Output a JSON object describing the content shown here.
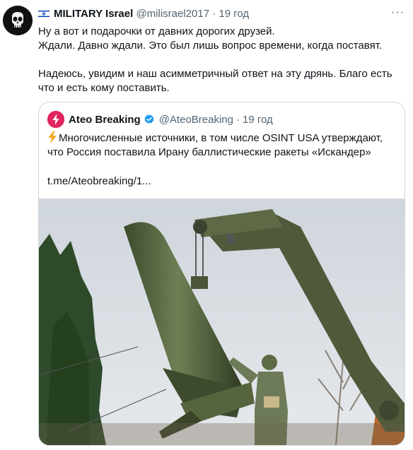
{
  "tweet": {
    "author": {
      "name": "MILITARY Israel",
      "handle": "@milisrael2017",
      "separator": "·",
      "time": "19 год"
    },
    "text": "Ну а вот и подарочки от давних дорогих друзей.\nЖдали. Давно ждали. Это был лишь вопрос времени, когда поставят.\n\nНадеюсь, увидим и наш асимметричный ответ на эту дрянь. Благо есть что и есть кому поставить.",
    "more_label": "···"
  },
  "quote": {
    "author": {
      "name": "Ateo Breaking",
      "handle": "@AteoBreaking",
      "separator": "·",
      "time": "19 год"
    },
    "text": "Многочисленные источники, в том числе OSINT USA утверждают, что Россия поставила Ирану баллистические ракеты «Искандер»",
    "link": "t.me/Ateobreaking/1..."
  },
  "icons": {
    "flag": "israel-flag-icon",
    "verified": "verified-badge-icon",
    "bolt": "lightning-icon",
    "more": "more-icon"
  },
  "colors": {
    "verified": "#1d9bf0",
    "brand_red": "#e0245e",
    "secondary_text": "#536471",
    "border": "#cfd9de"
  }
}
